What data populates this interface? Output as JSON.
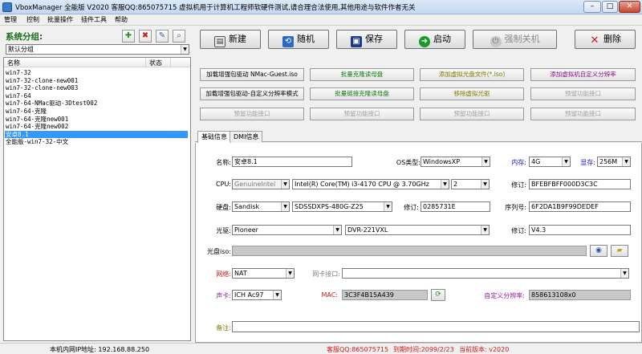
{
  "window": {
    "title": "VboxManager 全能版 V2020 客服QQ:865075715 虚拟机用于计算机工程师软硬件测试,请合理合法使用,其他用途与软件作者无关",
    "controls": {
      "minimize": "–",
      "maximize": "□",
      "close": "✕"
    }
  },
  "menu": [
    "管理",
    "控制",
    "批量操作",
    "插件工具",
    "帮助"
  ],
  "group": {
    "title": "系统分组:",
    "selected": "默认分组",
    "icons": [
      "add-icon",
      "delete-icon",
      "edit-icon",
      "search-icon"
    ]
  },
  "vmlist": {
    "columns": [
      "名称",
      "状态"
    ],
    "items": [
      "win7-32",
      "win7-32-clone-new001",
      "win7-32-clone-new003",
      "win7-64",
      "win7-64-NMac驱动-3Dtest002",
      "win7-64-克隆",
      "win7-64-克隆new001",
      "win7-64-克隆new002",
      "安卓8.1",
      "全能版-win7-32-中文"
    ],
    "selected_index": 8
  },
  "toolbar": {
    "new": "新建",
    "random": "随机",
    "save": "保存",
    "start": "启动",
    "force_off": "强制关机",
    "delete": "删除"
  },
  "actions": [
    {
      "label": "加载增强包驱动 NMac-Guest.iso",
      "style": "blk"
    },
    {
      "label": "批量克隆读母盘",
      "style": "grn"
    },
    {
      "label": "添加虚拟光盘文件(*.iso)",
      "style": "olv"
    },
    {
      "label": "添加虚拟机自定义分辨率",
      "style": "pur"
    },
    {
      "label": "加载增强包驱动-自定义分辨率模式",
      "style": "blk"
    },
    {
      "label": "批量链接克隆读母盘",
      "style": "grn"
    },
    {
      "label": "移除虚拟光驱",
      "style": "olv"
    },
    {
      "label": "预留功能接口",
      "style": "dis"
    },
    {
      "label": "预留功能接口",
      "style": "dis"
    },
    {
      "label": "预留功能接口",
      "style": "dis"
    },
    {
      "label": "预留功能接口",
      "style": "dis"
    },
    {
      "label": "预留功能接口",
      "style": "dis"
    }
  ],
  "tabs": [
    "基础信息",
    "DMI信息"
  ],
  "form": {
    "name_label": "名称:",
    "name": "安卓8.1",
    "os_label": "OS类型:",
    "os": "WindowsXP",
    "mem_label": "内存:",
    "mem": "4G",
    "vram_label": "显存:",
    "vram": "256M",
    "cpu_label": "CPU:",
    "cpu_vendor": "GenuineIntel",
    "cpu_model": "Intel(R) Core(TM) i3-4170 CPU @ 3.70GHz",
    "cpu_count": "2",
    "rev_label": "修订:",
    "cpu_rev": "BFEBFBFF000D3C3C",
    "disk_label": "硬盘:",
    "disk_vendor": "Sandisk",
    "disk_model": "SDSSDXPS-480G-Z25",
    "disk_rev_label": "修订:",
    "disk_rev": "0285731E",
    "serial_label": "序列号:",
    "serial": "6F2DA1B9F99DEDEF",
    "optical_label": "光驱:",
    "optical_vendor": "Pioneer",
    "optical_model": "DVR-221VXL",
    "optical_rev_label": "修订:",
    "optical_rev": "V4.3",
    "iso_label": "光盘iso:",
    "iso": "",
    "net_label": "网络:",
    "net": "NAT",
    "nic_label": "网卡接口:",
    "nic": "",
    "sound_label": "声卡:",
    "sound": "ICH Ac97",
    "mac_label": "MAC:",
    "mac": "3C3F4B15A439",
    "res_label": "自定义分辨率:",
    "res": "858613108x0",
    "note_label": "备注:",
    "note": ""
  },
  "status": {
    "ip": "本机内网IP地址: 192.168.88.250",
    "qq": "客服QQ:865075715",
    "expire": "到期时间:2099/2/23",
    "version": "当前版本: v2020"
  },
  "colors": {
    "selection": "#3399ff",
    "green": "#1a7a1a",
    "red": "#cc1a1a",
    "blue": "#1a1ad0",
    "purple": "#9a1aa0"
  }
}
